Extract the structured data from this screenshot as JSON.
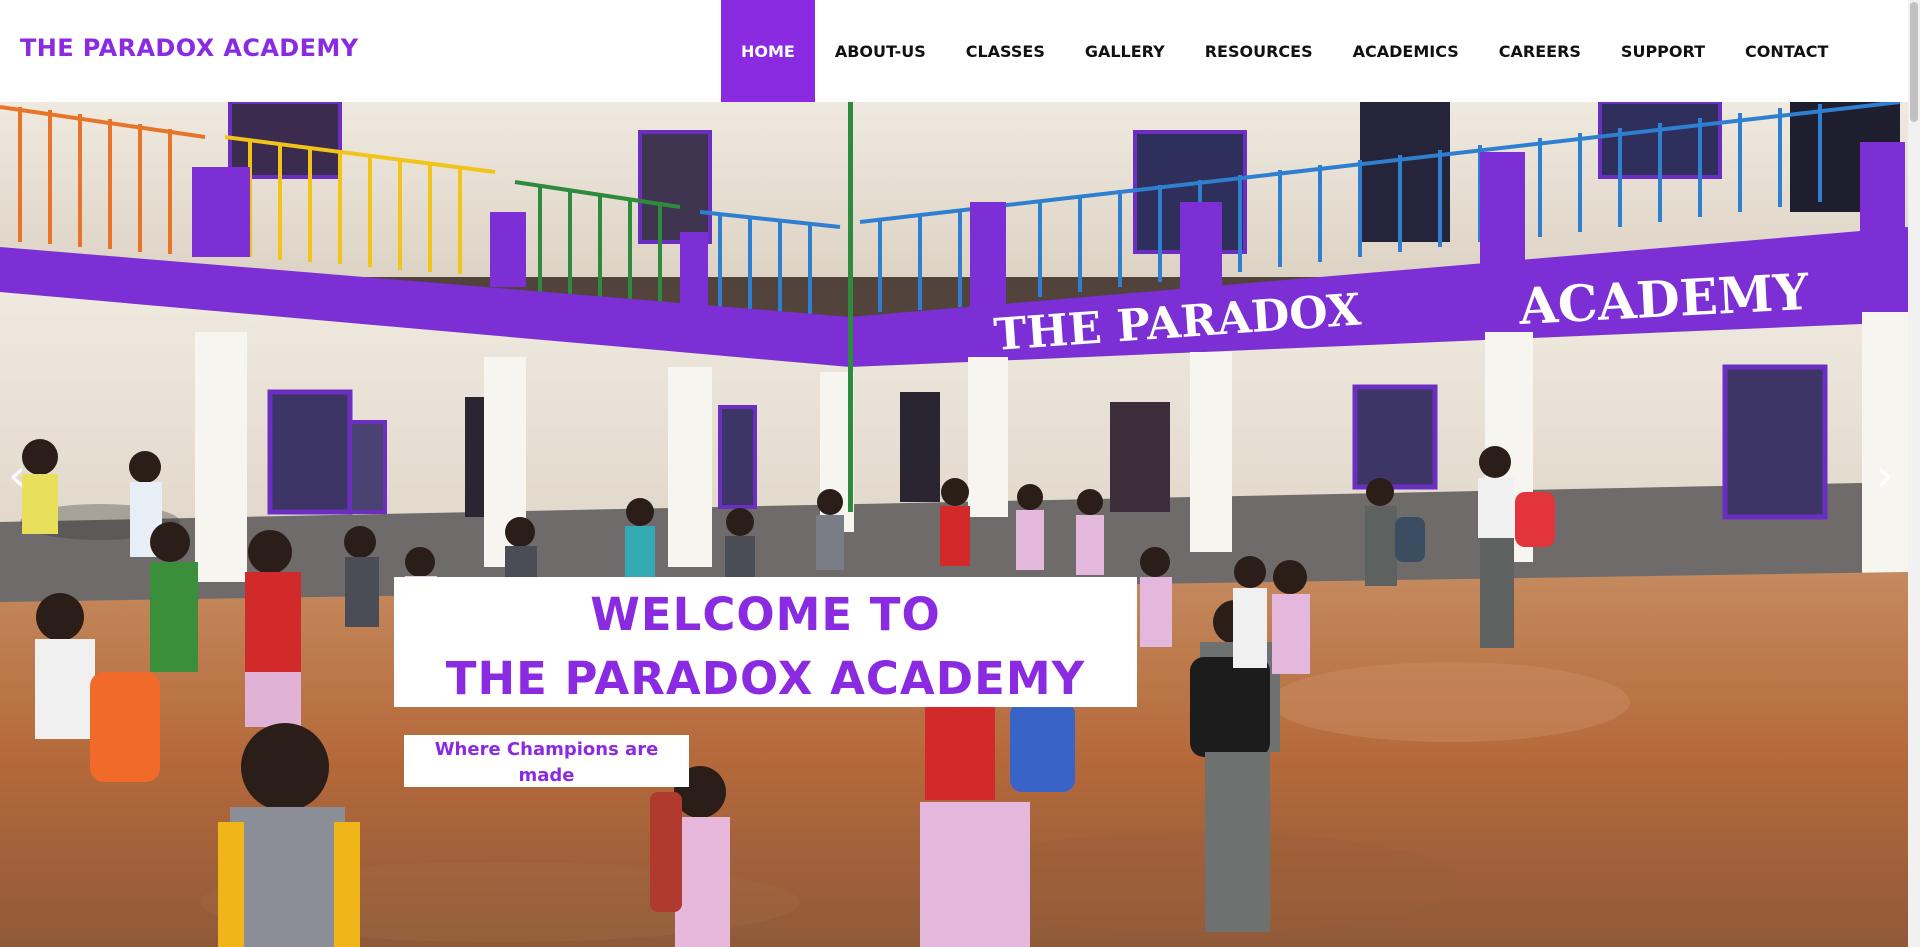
{
  "brand": {
    "name": "THE PARADOX ACADEMY"
  },
  "nav": {
    "items": [
      {
        "label": "HOME",
        "active": true
      },
      {
        "label": "ABOUT-US",
        "active": false
      },
      {
        "label": "CLASSES",
        "active": false
      },
      {
        "label": "GALLERY",
        "active": false
      },
      {
        "label": "RESOURCES",
        "active": false
      },
      {
        "label": "ACADEMICS",
        "active": false
      },
      {
        "label": "CAREERS",
        "active": false
      },
      {
        "label": "SUPPORT",
        "active": false
      },
      {
        "label": "CONTACT",
        "active": false
      }
    ]
  },
  "hero": {
    "welcome_line_1": "WELCOME TO",
    "welcome_line_2": "THE PARADOX ACADEMY",
    "tagline": "Where Champions are made",
    "building_sign": "THE PARADOX ACADEMY",
    "prev_icon": "chevron-left-icon",
    "next_icon": "chevron-right-icon"
  },
  "colors": {
    "accent": "#8a2be2",
    "building_trim": "#7b2fd4",
    "soil": "#b5693a"
  }
}
